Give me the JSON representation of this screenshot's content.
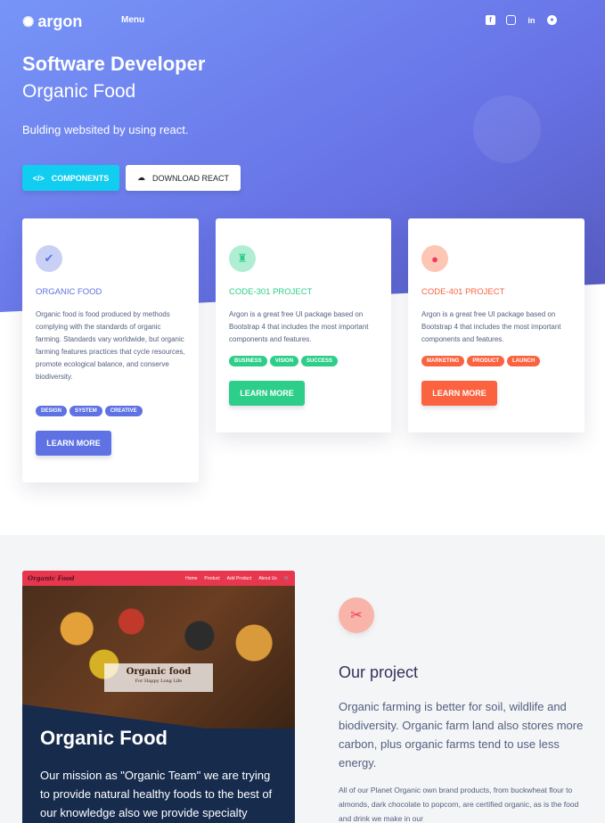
{
  "nav": {
    "logo": "argon",
    "menu": "Menu",
    "socials": [
      "facebook-icon",
      "instagram-icon",
      "linkedin-icon",
      "github-icon"
    ]
  },
  "hero": {
    "title": "Software Developer",
    "subtitle": "Organic Food",
    "lead": "Bulding websited by using react.",
    "btn_components": "COMPONENTS",
    "btn_download": "DOWNLOAD REACT"
  },
  "cards": [
    {
      "title": "ORGANIC FOOD",
      "color": "#5e72e4",
      "icon": "check-icon",
      "text": "Organic food is food produced by methods complying with the standards of organic farming. Standards vary worldwide, but organic farming features practices that cycle resources, promote ecological balance, and conserve biodiversity.",
      "tags": [
        "DESIGN",
        "SYSTEM",
        "CREATIVE"
      ],
      "button": "LEARN MORE"
    },
    {
      "title": "CODE-301 PROJECT",
      "color": "#2dce89",
      "icon": "building-icon",
      "text": "Argon is a great free UI package based on Bootstrap 4 that includes the most important components and features.",
      "tags": [
        "BUSINESS",
        "VISION",
        "SUCCESS"
      ],
      "button": "LEARN MORE"
    },
    {
      "title": "CODE-401 PROJECT",
      "color": "#fb6340",
      "icon": "planet-icon",
      "text": "Argon is a great free UI package based on Bootstrap 4 that includes the most important components and features.",
      "tags": [
        "MARKETING",
        "PRODUCT",
        "LAUNCH"
      ],
      "button": "LEARN MORE"
    }
  ],
  "showcase": {
    "brand": "Organic Food",
    "links": [
      "Home",
      "Product",
      "Add Product",
      "About Us"
    ],
    "img_title": "Organic food",
    "img_sub": "For Happy Long Life",
    "title": "Organic Food",
    "text": "Our mission as \"Organic Team\" we are trying to provide natural healthy foods to the best of our knowledge also we provide specialty products"
  },
  "project": {
    "icon": "tools-icon",
    "title": "Our project",
    "lead": "Organic farming is better for soil, wildlife and biodiversity. Organic farm land also stores more carbon, plus organic farms tend to use less energy.",
    "text": "All of our Planet Organic own brand products, from buckwheat flour to almonds, dark chocolate to popcorn, are certified organic, as is the food and drink we make in our"
  }
}
